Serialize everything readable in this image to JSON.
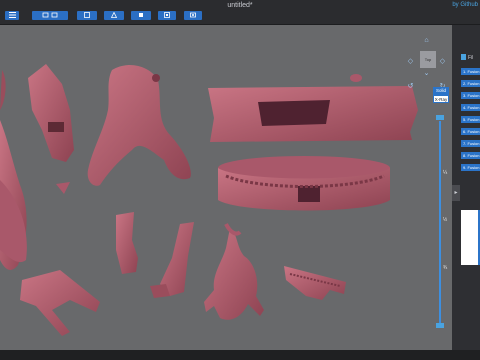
{
  "window": {
    "title": "untitled*",
    "brand": "by Github"
  },
  "toolbar": {
    "buttons": [
      "menu-icon",
      "folder-icon",
      "image-icon",
      "tools-icon",
      "cube-icon",
      "frame-icon",
      "camera-icon"
    ]
  },
  "view_controls": {
    "cube_label": "Top",
    "mode_solid": "Solid",
    "mode_xray": "X-Ray",
    "ticks": [
      "¼",
      "½",
      "¾"
    ]
  },
  "panel": {
    "title": "Fil",
    "items": [
      "1. Fusion",
      "2. Fusion",
      "3. Fusion",
      "4. Fusion",
      "5. Fusion",
      "6. Fusion",
      "7. Fusion",
      "8. Fusion",
      "9. Fusion"
    ],
    "collapse_icon": "chevron-right-icon"
  },
  "colors": {
    "model": "#b15d6c",
    "viewport": "#68696b",
    "accent": "#2b74c9"
  }
}
